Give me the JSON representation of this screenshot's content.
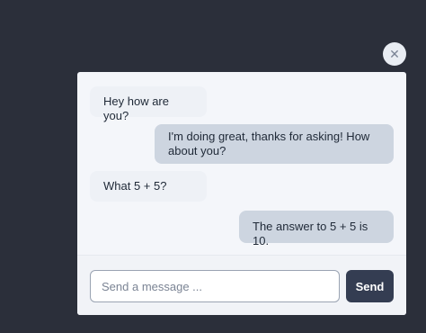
{
  "close_icon": "close-icon",
  "chat": {
    "messages": [
      {
        "role": "bot",
        "text": "Hey how are you?"
      },
      {
        "role": "user",
        "text": "I'm doing great, thanks for asking! How about you?"
      },
      {
        "role": "bot",
        "text": "What 5 + 5?"
      },
      {
        "role": "user",
        "text": "The answer to 5 + 5 is 10."
      }
    ]
  },
  "composer": {
    "placeholder": "Send a message ...",
    "value": "",
    "send_label": "Send"
  },
  "colors": {
    "backdrop": "#2b2f3a",
    "panel": "#f4f6fa",
    "bot_bubble": "#eef1f6",
    "user_bubble": "#cdd5e0",
    "send_button": "#343d52"
  }
}
